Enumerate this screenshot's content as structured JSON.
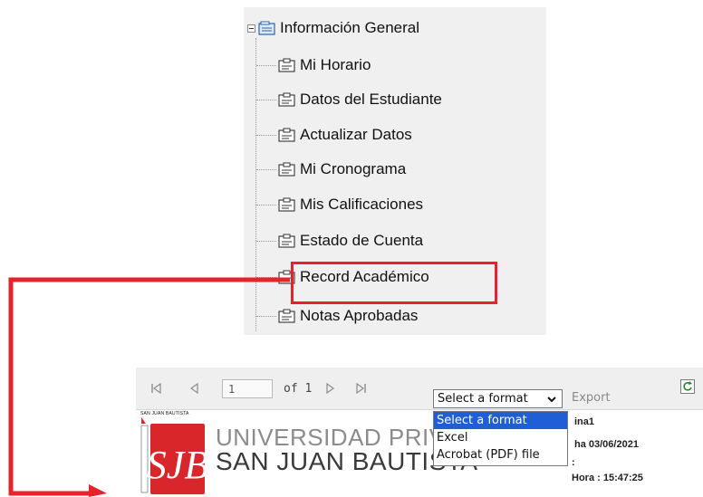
{
  "tree": {
    "root_label": "Información General",
    "items": [
      {
        "label": "Mi Horario"
      },
      {
        "label": "Datos del Estudiante"
      },
      {
        "label": "Actualizar Datos"
      },
      {
        "label": "Mi Cronograma"
      },
      {
        "label": "Mis Calificaciones"
      },
      {
        "label": "Estado de Cuenta"
      },
      {
        "label": "Record Académico",
        "highlighted": true
      },
      {
        "label": "Notas Aprobadas"
      }
    ],
    "highlight_color": "#e8212b"
  },
  "viewer": {
    "toolbar": {
      "page_value": "1",
      "of_label": "of 1",
      "format_selected": "Select a format",
      "export_label": "Export",
      "icons": [
        "first-page-icon",
        "previous-page-icon",
        "next-page-icon",
        "last-page-icon",
        "refresh-icon",
        "chevron-down-icon"
      ]
    },
    "format_options": [
      "Select a format",
      "Excel",
      "Acrobat (PDF) file"
    ],
    "selected_option_color": "#1e5fd6",
    "report": {
      "seal_text": "SAN JUAN BAUTISTA",
      "logo_letters": "SJB",
      "university_line1": "UNIVERSIDAD PRIVADA",
      "university_line2": "SAN JUAN BAUTISTA",
      "page_label": "ina1",
      "date_label": "ha  03/06/2021",
      "colon": ":",
      "time_label": "Hora :  15:47:25",
      "brand_color": "#d9262b"
    }
  }
}
